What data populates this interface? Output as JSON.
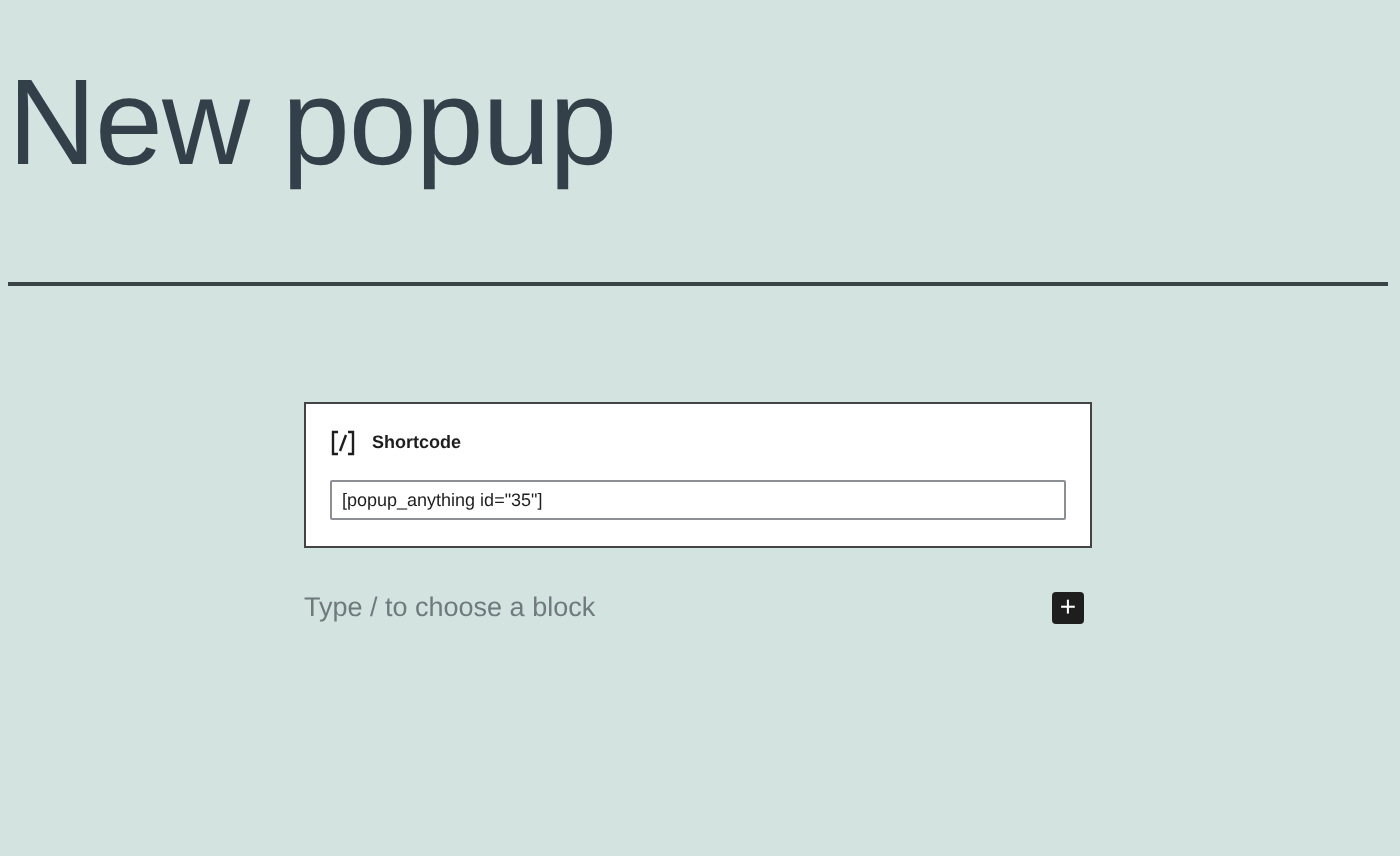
{
  "post_title": "New popup",
  "shortcode_block": {
    "label": "Shortcode",
    "value": "[popup_anything id=\"35\"]"
  },
  "appender": {
    "placeholder": "Type / to choose a block",
    "add_button": "+"
  }
}
